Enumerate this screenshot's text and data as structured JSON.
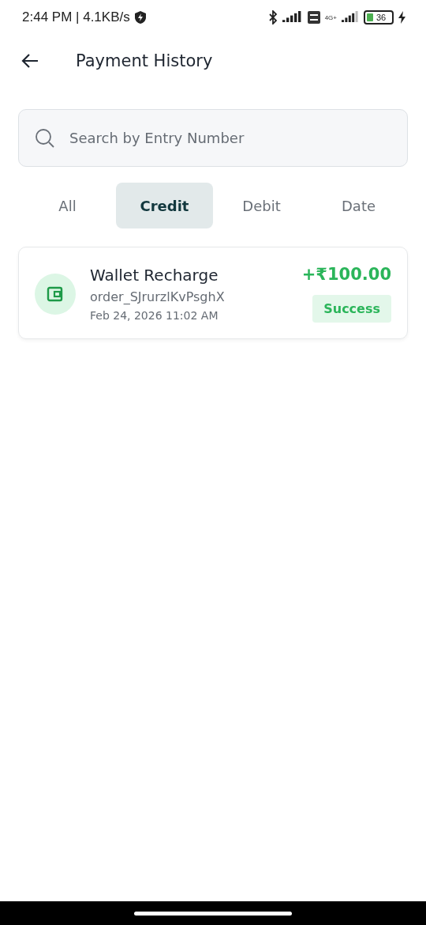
{
  "status_bar": {
    "time": "2:44 PM | 4.1KB/s",
    "network_type": "4G+",
    "battery": "36"
  },
  "header": {
    "title": "Payment History"
  },
  "search": {
    "placeholder": "Search by Entry Number"
  },
  "tabs": [
    {
      "label": "All",
      "selected": false
    },
    {
      "label": "Credit",
      "selected": true
    },
    {
      "label": "Debit",
      "selected": false
    },
    {
      "label": "Date",
      "selected": false
    }
  ],
  "transactions": [
    {
      "title": "Wallet Recharge",
      "order": "order_SJrurzlKvPsghX",
      "date": "Feb 24, 2026 11:02 AM",
      "amount": "+₹100.00",
      "status": "Success"
    }
  ]
}
